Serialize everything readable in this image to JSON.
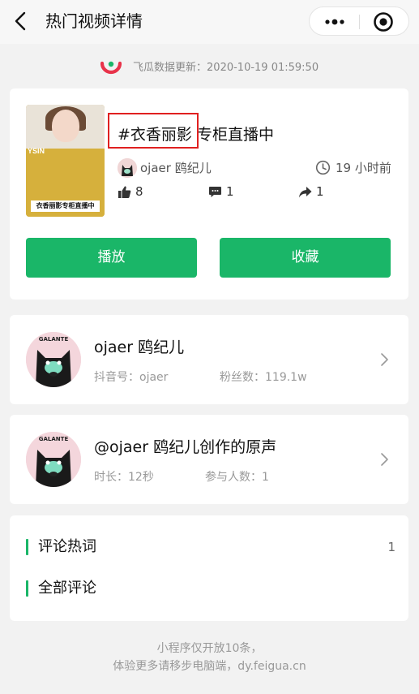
{
  "navbar": {
    "title": "热门视频详情",
    "back_icon": "chevron-left-icon",
    "more_icon": "more-dots-icon",
    "target_icon": "target-icon"
  },
  "update": {
    "logo_icon": "feigua-logo-icon",
    "text": "飞瓜数据更新：2020-10-19 01:59:50"
  },
  "video": {
    "thumbnail_text_left": "YSIN",
    "thumbnail_banner": "衣香丽影专柜直播中",
    "title": "#衣香丽影 专柜直播中",
    "author": "ojaer 鸥纪儿",
    "time": "19 小时前",
    "likes": "8",
    "comments": "1",
    "shares": "1",
    "play_label": "播放",
    "favorite_label": "收藏"
  },
  "user": {
    "name": "ojaer 鸥纪儿",
    "douyin_id": "抖音号：ojaer",
    "fans": "粉丝数：119.1w"
  },
  "music": {
    "title": "@ojaer 鸥纪儿创作的原声",
    "duration": "时长：12秒",
    "participants": "参与人数：1"
  },
  "comments": {
    "hot_words_label": "评论热词",
    "hot_words_count": "1",
    "all_label": "全部评论"
  },
  "footer": {
    "line1": "小程序仅开放10条，",
    "line2": "体验更多请移步电脑端，dy.feigua.cn"
  },
  "colors": {
    "accent": "#1ab668",
    "highlight_box": "#e02020"
  }
}
